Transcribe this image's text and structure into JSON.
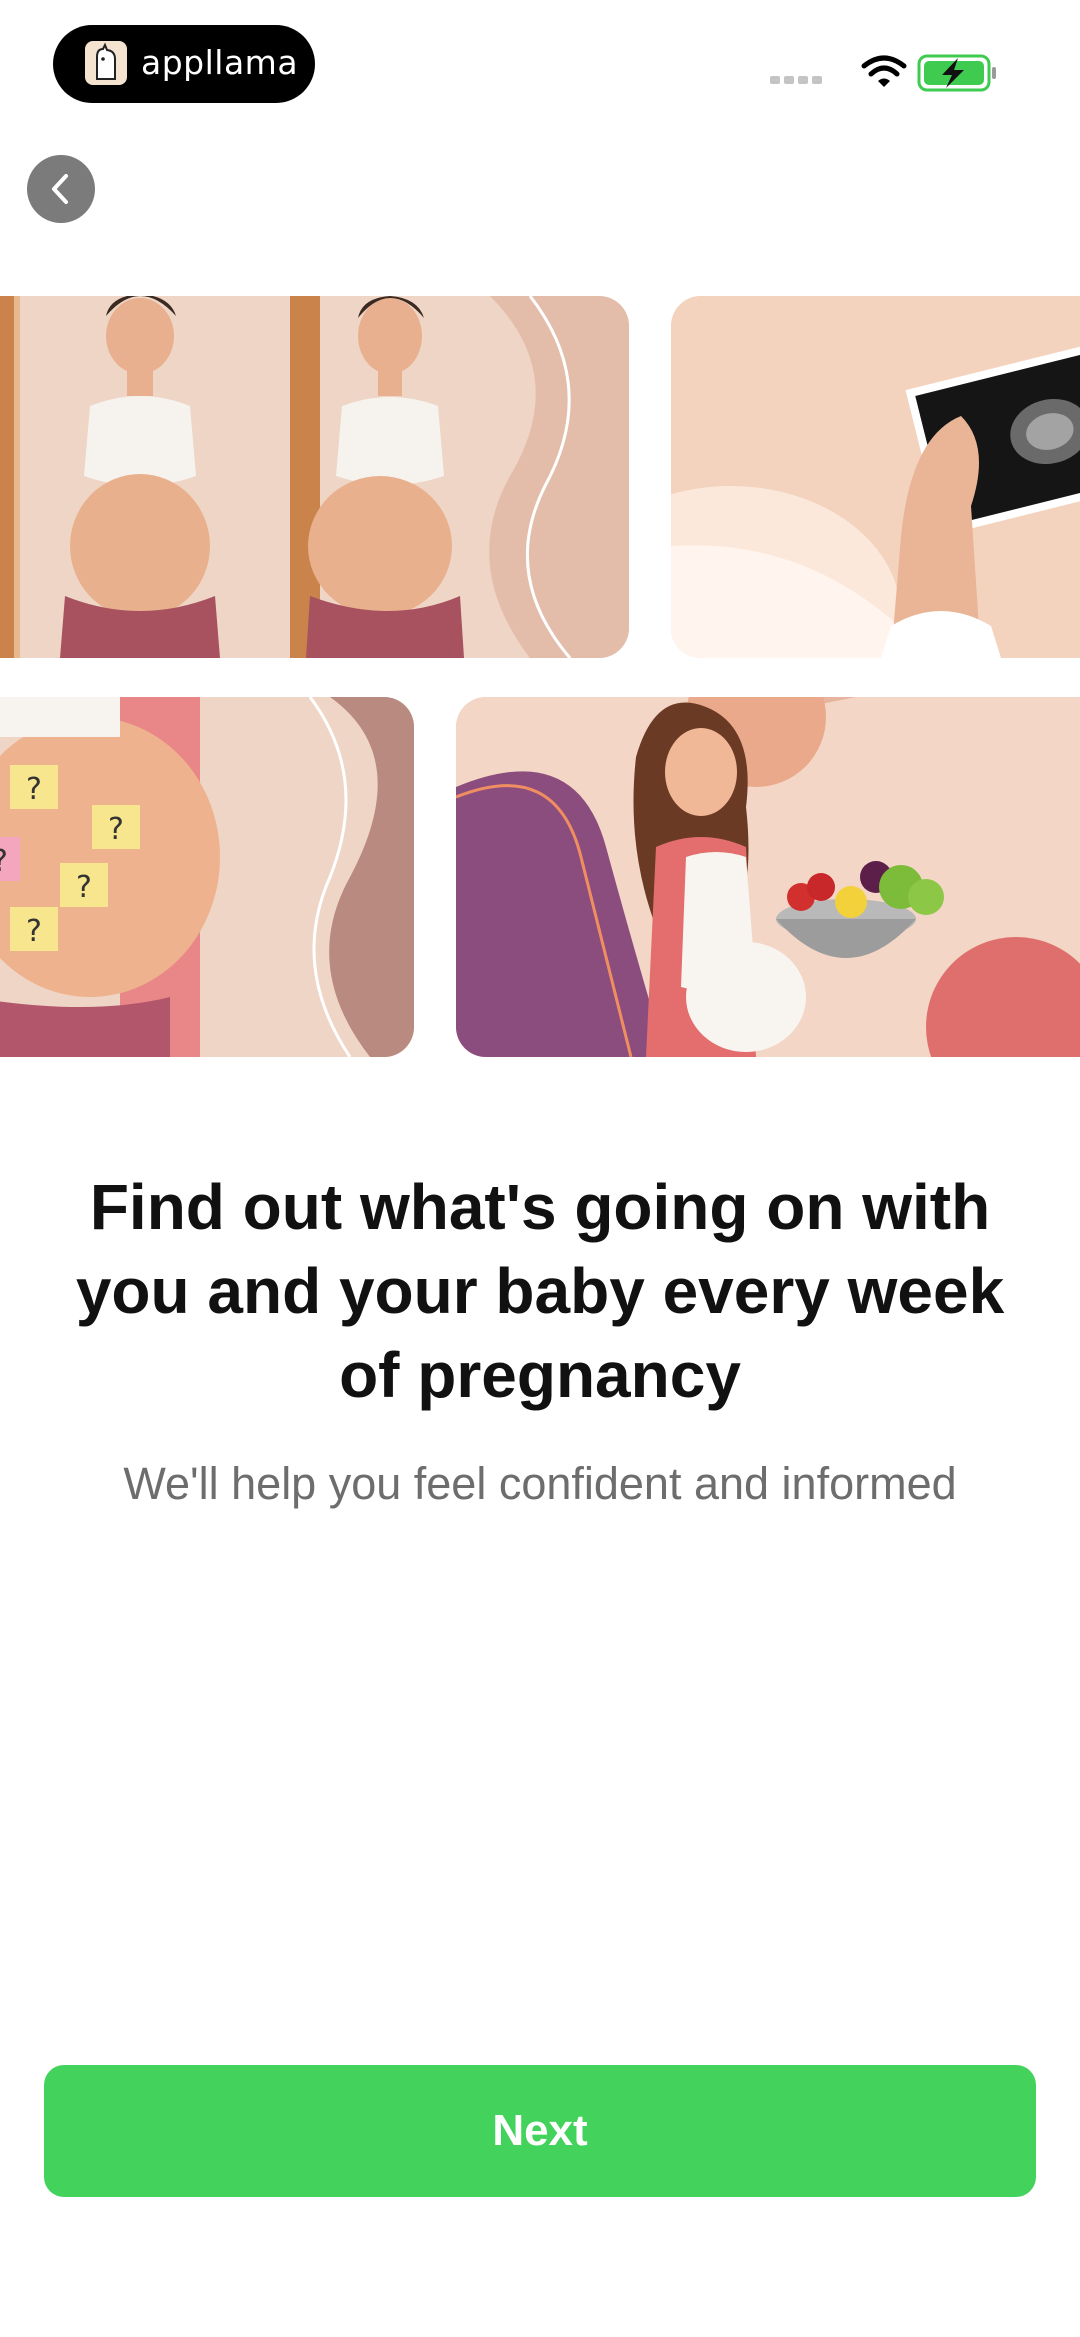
{
  "status_bar": {
    "app_badge_text": "appllama",
    "icons": [
      "appllama-logo-icon",
      "signal-dots-icon",
      "wifi-icon",
      "battery-charging-icon"
    ]
  },
  "nav": {
    "back_icon": "chevron-left-icon"
  },
  "gallery": {
    "images": [
      "pregnant-woman-mirror",
      "ultrasound-photo",
      "belly-question-notes",
      "woman-fruit-bowl"
    ]
  },
  "content": {
    "headline_lines": [
      "Find out what's going on with",
      "you and your baby every week",
      "of pregnancy"
    ],
    "subtitle": "We'll help you feel confident and informed"
  },
  "actions": {
    "next_label": "Next"
  },
  "colors": {
    "accent_green": "#43d25b",
    "battery_green": "#3ecb4f"
  }
}
